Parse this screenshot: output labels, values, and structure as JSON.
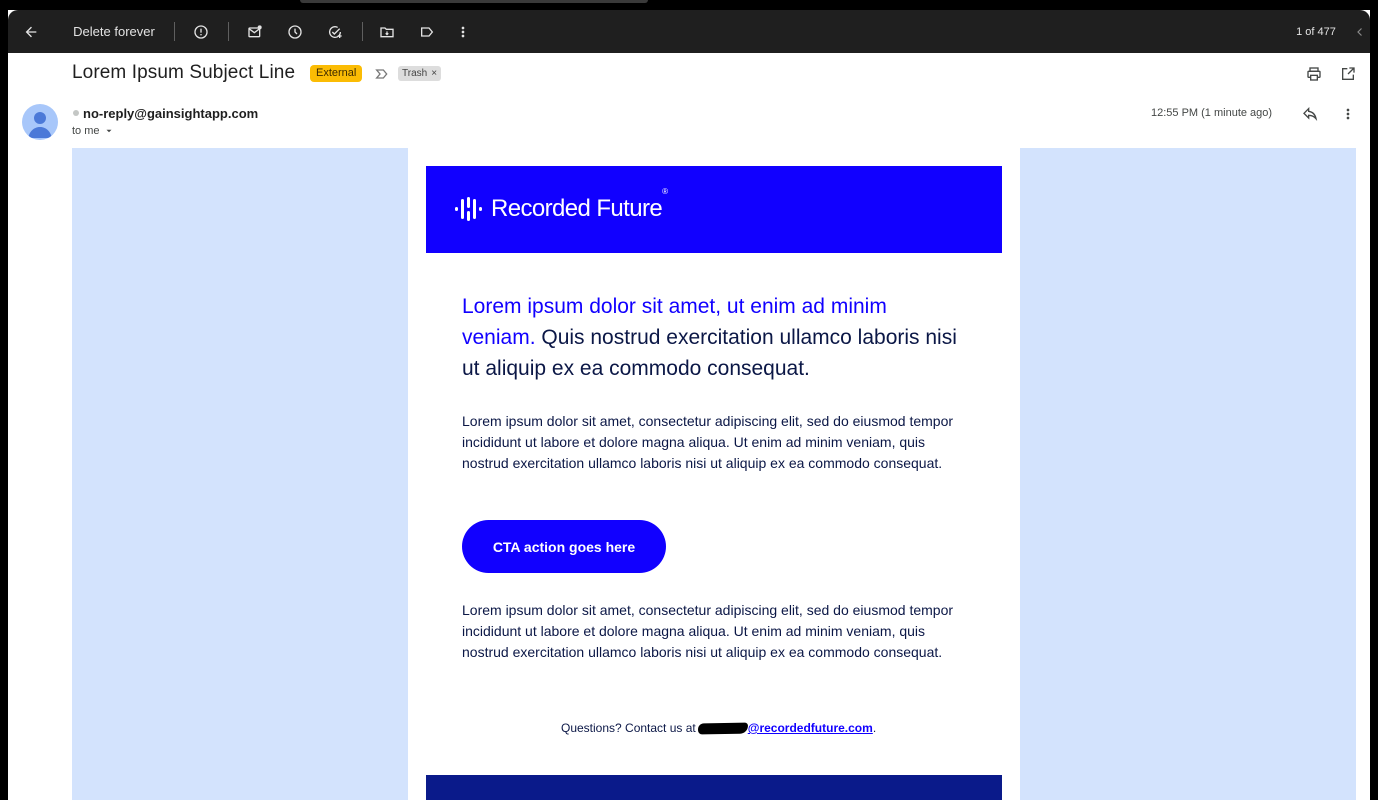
{
  "toolbar": {
    "delete_forever_label": "Delete forever",
    "pagination": "1 of 477"
  },
  "subject": {
    "title": "Lorem Ipsum Subject Line",
    "external_badge": "External",
    "trash_label": "Trash",
    "trash_remove": "×"
  },
  "sender": {
    "email": "no-reply@gainsightapp.com",
    "to": "to me",
    "timestamp": "12:55 PM (1 minute ago)"
  },
  "email": {
    "brand": "Recorded Future",
    "brand_mark": "®",
    "headline_accent": "Lorem ipsum dolor sit amet, ut enim ad minim veniam.",
    "headline_rest": " Quis nostrud exercitation ullamco laboris nisi ut aliquip ex ea commodo consequat.",
    "paragraph1": "Lorem ipsum dolor sit amet, consectetur adipiscing elit, sed do eiusmod tempor incididunt ut labore et dolore magna aliqua. Ut enim ad minim veniam, quis nostrud exercitation ullamco laboris nisi ut aliquip ex ea commodo consequat.",
    "cta_label": "CTA action goes here",
    "paragraph2": "Lorem ipsum dolor sit amet, consectetur adipiscing elit, sed do eiusmod tempor incididunt ut labore et dolore magna aliqua. Ut enim ad minim veniam, quis nostrud exercitation ullamco laboris nisi ut aliquip ex ea commodo consequat.",
    "contact_prefix": "Questions? Contact us at",
    "contact_email_domain": "@recordedfuture.com",
    "contact_suffix": "."
  },
  "colors": {
    "brand_blue": "#1100ff",
    "body_text": "#0b1746",
    "outer_background": "#d3e3fd",
    "footer_navy": "#0a1a8a",
    "external_badge": "#fbbc04"
  },
  "icons": {
    "toolbar": [
      "back-arrow-icon",
      "report-spam-icon",
      "mark-unread-icon",
      "snooze-icon",
      "add-task-icon",
      "move-to-icon",
      "label-icon",
      "more-vert-icon",
      "chevron-left-icon"
    ],
    "header": [
      "print-icon",
      "open-in-new-window-icon",
      "reply-icon",
      "more-vert-icon",
      "label-importance-icon"
    ]
  }
}
